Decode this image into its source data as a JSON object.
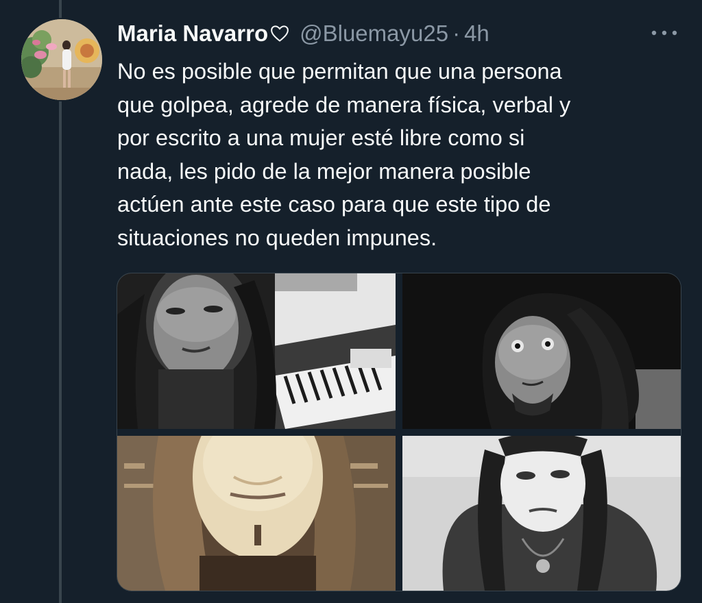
{
  "tweet": {
    "author": {
      "display_name": "Maria Navarro",
      "badge_icon": "heart-outline-icon",
      "handle": "@Bluemayu25",
      "separator": "·",
      "timestamp": "4h"
    },
    "more_icon": "more-horizontal-icon",
    "text": "No es posible que permitan que una persona\nque golpea, agrede  de manera física, verbal y\npor escrito a una mujer esté libre como si\nnada, les pido de la mejor manera posible\nactúen ante este caso para que este tipo de\nsituaciones no queden impunes.",
    "media_count": 4,
    "colors": {
      "background": "#15202b",
      "text_primary": "#f7f9f9",
      "text_secondary": "#8b98a5",
      "border": "#38444d"
    }
  }
}
